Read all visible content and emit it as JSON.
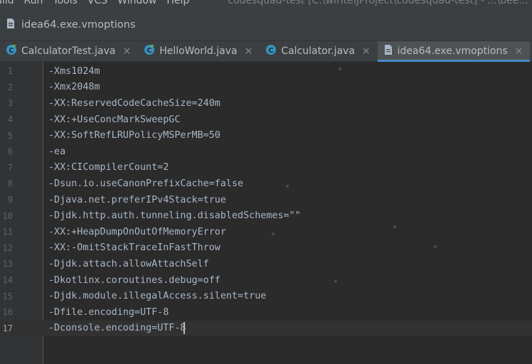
{
  "menubar": {
    "items": [
      "uild",
      "Run",
      "Tools",
      "VCS",
      "Window",
      "Help"
    ],
    "window_title": "codesquad-test [C:\\wiriteIJProject\\codesquad-test] - ...\\bee..."
  },
  "navbar": {
    "icon": "file-text-icon",
    "breadcrumb": "idea64.exe.vmoptions"
  },
  "tabs": [
    {
      "label": "CalculatorTest.java",
      "icon": "java-class-test-icon",
      "active": false
    },
    {
      "label": "HelloWorld.java",
      "icon": "java-class-icon",
      "active": false
    },
    {
      "label": "Calculator.java",
      "icon": "java-class-icon",
      "active": false
    },
    {
      "label": "idea64.exe.vmoptions",
      "icon": "file-text-icon",
      "active": true
    }
  ],
  "tab_close_glyph": "×",
  "editor": {
    "lines": [
      {
        "no": "1",
        "text": "-Xms1024m"
      },
      {
        "no": "2",
        "text": "-Xmx2048m"
      },
      {
        "no": "3",
        "text": "-XX:ReservedCodeCacheSize=240m"
      },
      {
        "no": "4",
        "text": "-XX:+UseConcMarkSweepGC"
      },
      {
        "no": "5",
        "text": "-XX:SoftRefLRUPolicyMSPerMB=50"
      },
      {
        "no": "6",
        "text": "-ea"
      },
      {
        "no": "7",
        "text": "-XX:CICompilerCount=2"
      },
      {
        "no": "8",
        "text": "-Dsun.io.useCanonPrefixCache=false"
      },
      {
        "no": "9",
        "text": "-Djava.net.preferIPv4Stack=true"
      },
      {
        "no": "10",
        "text": "-Djdk.http.auth.tunneling.disabledSchemes=\"\""
      },
      {
        "no": "11",
        "text": "-XX:+HeapDumpOnOutOfMemoryError"
      },
      {
        "no": "12",
        "text": "-XX:-OmitStackTraceInFastThrow"
      },
      {
        "no": "13",
        "text": "-Djdk.attach.allowAttachSelf"
      },
      {
        "no": "14",
        "text": "-Dkotlinx.coroutines.debug=off"
      },
      {
        "no": "15",
        "text": "-Djdk.module.illegalAccess.silent=true"
      },
      {
        "no": "16",
        "text": "-Dfile.encoding=UTF-8"
      },
      {
        "no": "17",
        "text": "-Dconsole.encoding=UTF-8"
      }
    ],
    "caret_line": "17"
  },
  "colors": {
    "background": "#2b2b2b",
    "gutter": "#313335",
    "text": "#a9b7c6",
    "active_tab_underline": "#4a88c7",
    "java_icon": "#3592c4",
    "test_icon_accent": "#62b543"
  }
}
